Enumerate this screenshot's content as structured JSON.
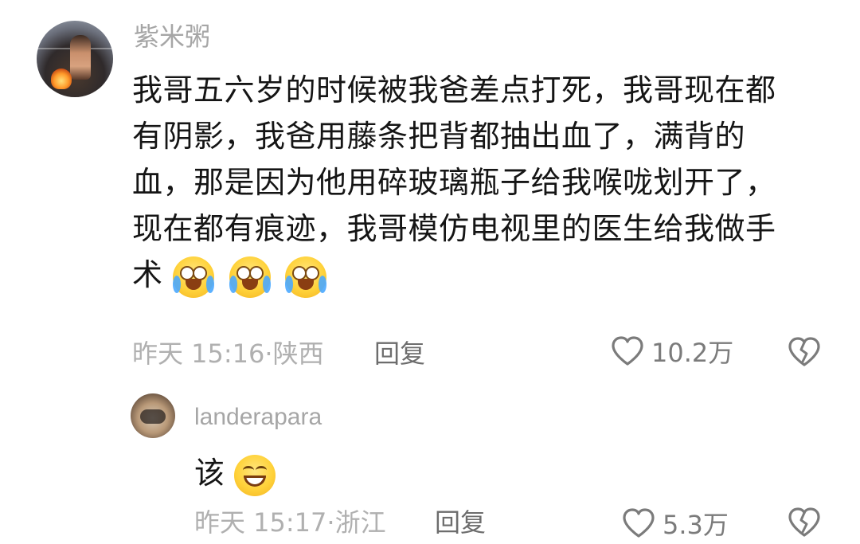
{
  "comment": {
    "username": "紫米粥",
    "lines": [
      "我哥五六岁的时候被我爸差点打死，我哥现在都",
      "有阴影，我爸用藤条把背都抽出血了，满背的",
      "血，那是因为他用碎玻璃瓶子给我喉咙划开了，",
      "现在都有痕迹，我哥模仿电视里的医生给我做手",
      "术"
    ],
    "emojis": [
      "crying-laughing-emoji",
      "crying-laughing-emoji",
      "crying-laughing-emoji"
    ],
    "timestamp": "昨天 15:16",
    "location": "陕西",
    "reply_label": "回复",
    "likes": "10.2万"
  },
  "reply": {
    "username": "landerapara",
    "text": "该",
    "emoji": "grinning-emoji",
    "timestamp": "昨天 15:17",
    "location": "浙江",
    "reply_label": "回复",
    "likes": "5.3万"
  },
  "icons": {
    "like": "heart-icon",
    "dislike": "broken-heart-icon"
  },
  "colors": {
    "text_primary": "#151515",
    "text_secondary": "#b0b0b0",
    "username": "#a6a6a6",
    "reply": "#6d6d6d",
    "icon": "#7b7b7b",
    "background": "#ffffff"
  }
}
